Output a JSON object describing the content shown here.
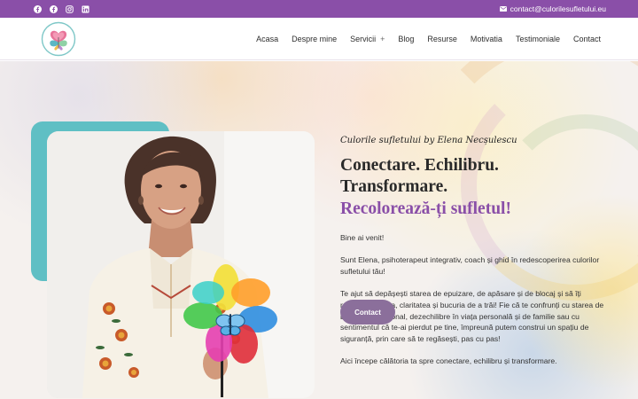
{
  "topbar": {
    "social": [
      {
        "icon": "facebook-icon"
      },
      {
        "icon": "facebook-circle-icon"
      },
      {
        "icon": "instagram-icon"
      },
      {
        "icon": "linkedin-icon"
      }
    ],
    "email": "contact@culorilesufletului.eu",
    "email_icon": "envelope-icon",
    "background": "#8a4fa8"
  },
  "header": {
    "nav": [
      {
        "label": "Acasa"
      },
      {
        "label": "Despre mine"
      },
      {
        "label": "Servicii",
        "submenu_indicator": "+"
      },
      {
        "label": "Blog"
      },
      {
        "label": "Resurse"
      },
      {
        "label": "Motivatia"
      },
      {
        "label": "Testimoniale"
      },
      {
        "label": "Contact"
      }
    ]
  },
  "hero": {
    "brand": "Culorile sufletului by Elena Necșulescu",
    "title_line1": "Conectare. Echilibru. Transformare.",
    "title_line2": "Recolorează-ți sufletul!",
    "paragraphs": [
      "Bine ai venit!",
      "Sunt Elena, psihoterapeut integrativ, coach și ghid în redescoperirea culorilor sufletului tău!",
      "Te ajut să depășești starea de epuizare, de apăsare și de blocaj și să îți recapeți puterea, claritatea și bucuria de a trăi! Fie că te confrunți cu starea de burnout profesional, dezechilibre în viața personală și de familie sau cu sentimentul că te-ai pierdut pe tine, împreună putem construi un spațiu de siguranță, prin care să te regăsești, pas cu pas!",
      "Aici începe călătoria ta spre conectare, echilibru și transformare."
    ],
    "button": "Contact",
    "colors": {
      "accent": "#8a4fa8",
      "teal": "#5fbfc4",
      "button": "#8b6f9b"
    }
  }
}
